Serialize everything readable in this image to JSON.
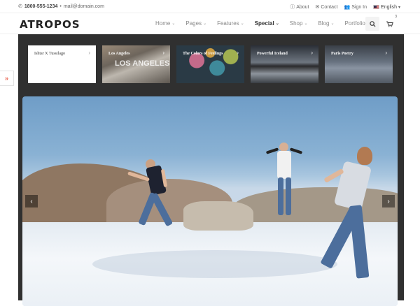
{
  "topbar": {
    "phone": "1800-555-1234",
    "separator": "•",
    "email": "mail@domain.com",
    "about": "About",
    "contact": "Contact",
    "signin": "Sign In",
    "language": "English"
  },
  "header": {
    "logo": "ATROPOS",
    "nav": [
      {
        "label": "Home"
      },
      {
        "label": "Pages"
      },
      {
        "label": "Features"
      },
      {
        "label": "Special"
      },
      {
        "label": "Shop"
      },
      {
        "label": "Blog"
      },
      {
        "label": "Portfolio"
      }
    ],
    "cart_count": "3"
  },
  "slider": {
    "thumbs": [
      {
        "title": "Ishtar X Tussilago"
      },
      {
        "title": "Los Angeles",
        "overlay": "LOS ANGELES"
      },
      {
        "title": "The Colors of Feelings"
      },
      {
        "title": "Powerful Iceland"
      },
      {
        "title": "Paris Poetry"
      }
    ]
  },
  "colors": {
    "accent": "#e8553f",
    "dark_panel": "#303030"
  }
}
